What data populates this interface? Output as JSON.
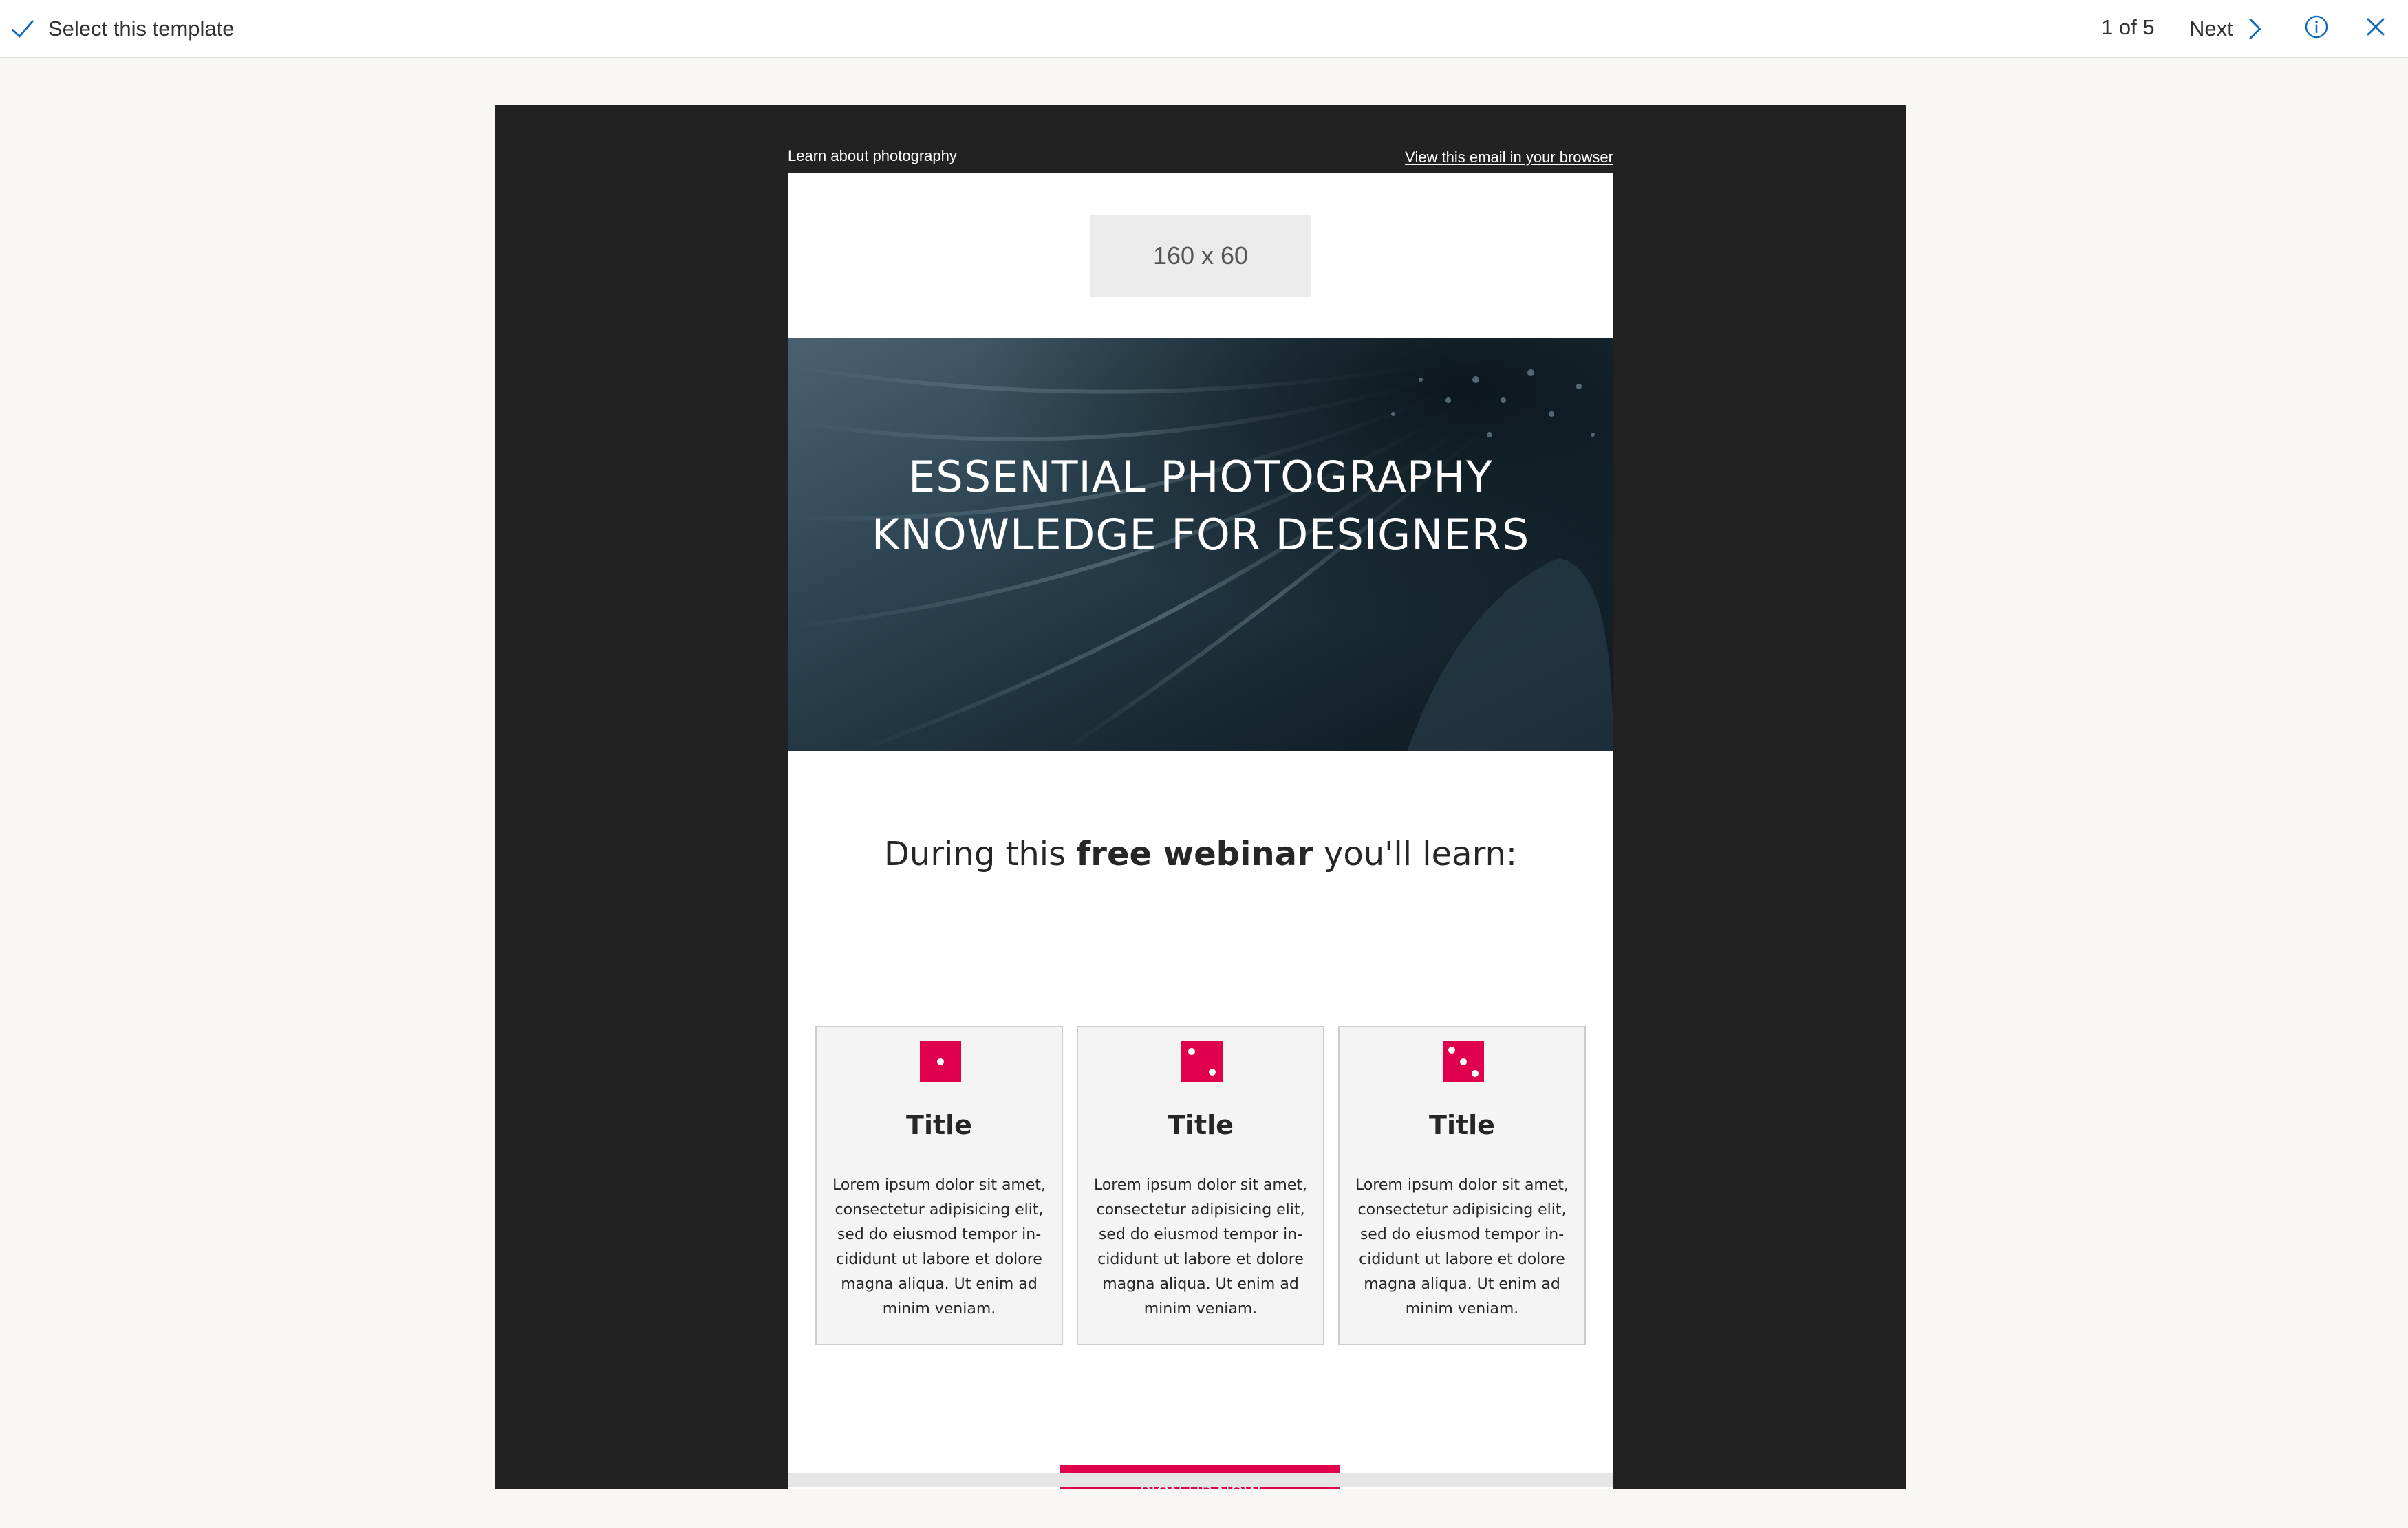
{
  "toolbar": {
    "select_label": "Select this template",
    "pager": "1 of 5",
    "next_label": "Next",
    "icons": {
      "check": "checkmark-icon",
      "next": "chevron-right-icon",
      "info": "info-icon",
      "close": "close-icon"
    },
    "accent_color": "#0f6cbd"
  },
  "email": {
    "preheader_left": "Learn about photography",
    "preheader_right": "View this email in your browser",
    "logo_placeholder": "160 x 60",
    "hero": {
      "line1": "ESSENTIAL PHOTOGRAPHY",
      "line2": "KNOWLEDGE FOR DESIGNERS"
    },
    "intro": {
      "before": "During this ",
      "bold": "free webinar",
      "after": " you'll learn:"
    },
    "cards": [
      {
        "icon": "dice-one-icon",
        "title": "Title",
        "body": "Lorem ipsum dolor sit amet, consectetur adipisicing elit, sed do eiusmod tempor in- cididunt ut labore et dolore magna aliqua. Ut enim ad minim veniam."
      },
      {
        "icon": "dice-two-icon",
        "title": "Title",
        "body": "Lorem ipsum dolor sit amet, consectetur adipisicing elit, sed do eiusmod tempor in- cididunt ut labore et dolore magna aliqua. Ut enim ad minim veniam."
      },
      {
        "icon": "dice-three-icon",
        "title": "Title",
        "body": "Lorem ipsum dolor sit amet, consectetur adipisicing elit, sed do eiusmod tempor in- cididunt ut labore et dolore magna aliqua. Ut enim ad minim veniam."
      }
    ],
    "cta_label": "SIGN UP NOW",
    "brand_color": "#e0004d",
    "frame_color": "#222222"
  }
}
